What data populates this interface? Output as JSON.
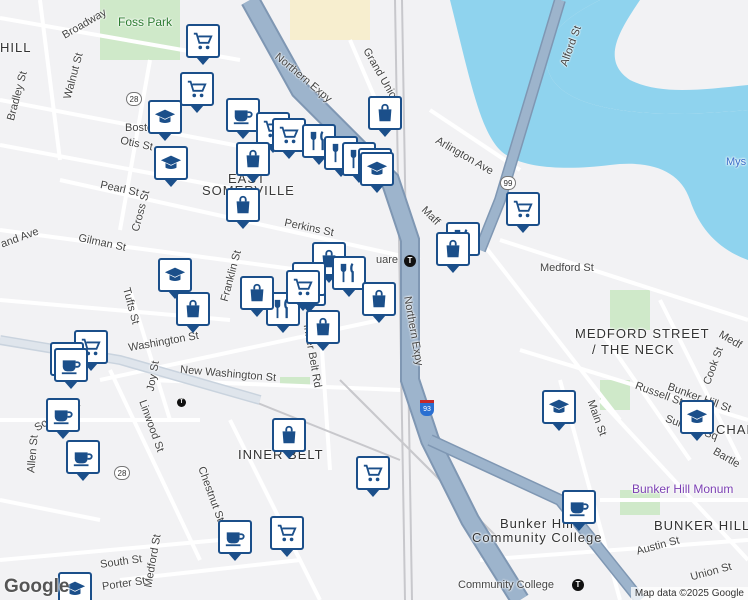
{
  "map": {
    "labels": {
      "foss_park": "Foss Park",
      "broadway": "Broadway",
      "walnut_st": "Walnut St",
      "bradley_st": "Bradley St",
      "boston_ave": "Boston Ave",
      "otis_st": "Otis St",
      "pearl_st": "Pearl St",
      "cross_st": "Cross St",
      "gilman_st": "Gilman St",
      "grand_ave": "and Ave",
      "east_somerville_1": "EAST",
      "east_somerville_2": "SOMERVILLE",
      "perkins_st": "Perkins St",
      "franklin_st": "Franklin St",
      "tufts_st": "Tufts St",
      "washington_st": "Washington St",
      "new_washington_st": "New Washington St",
      "inner_belt_rd": "Inner Belt Rd",
      "joy_st": "Joy St",
      "linwood_st": "Linwood St",
      "allen_st": "Allen St",
      "somerville_ave": "Somerville",
      "chestnut_st": "Chestnut St",
      "inner_belt": "INNER BELT",
      "south_st": "South St",
      "medford_st_w": "Medford St",
      "porter_st": "Porter St",
      "northern_expy_1": "Northern Expy",
      "northern_expy_2": "Northern Expy",
      "grand_union": "Grand Union",
      "arlington_ave": "Arlington Ave",
      "alford_st": "Alford St",
      "medford_st_e": "Medford St",
      "medford_street_neck_1": "MEDFORD STREET",
      "medford_street_neck_2": "/ THE NECK",
      "bunker_hill_st": "Bunker Hill St",
      "russell_st": "Russell St",
      "cook_st": "Cook St",
      "main_st": "Main St",
      "sullivan_sq": "Sullivan Sq",
      "bartlett": "Bartle",
      "bunker_hill_monument": "Bunker Hill Monum",
      "bunker_hill_area": "BUNKER HILL",
      "bunker_hill_cc_1": "Bunker Hill",
      "bunker_hill_cc_2": "Community College",
      "community_college_station": "Community College",
      "austin_st": "Austin St",
      "union_st": "Union St",
      "mys": "Mys",
      "hill": "HILL",
      "char": "CHAR",
      "medf": "Medf",
      "square": "uare",
      "maff": "Maff"
    },
    "route_28_a": "28",
    "route_28_b": "28",
    "route_99": "99",
    "interstate_93": "93",
    "transit_symbol": "T",
    "google_logo": "Google",
    "attribution": "Map data ©2025 Google",
    "colors": {
      "water": "#8fd3ee",
      "highway": "#9db4cc",
      "highway_edge": "#7f97b3",
      "road": "#ffffff",
      "park": "#cfe9c9",
      "pin_border": "#1b4f8a",
      "industrial": "#f7eecf"
    },
    "markers": [
      {
        "icon": "shopping-cart-icon"
      },
      {
        "icon": "shopping-cart-icon"
      },
      {
        "icon": "graduation-cap-icon"
      },
      {
        "icon": "coffee-cup-icon"
      },
      {
        "icon": "shopping-cart-icon"
      },
      {
        "icon": "shopping-cart-icon"
      },
      {
        "icon": "restaurant-icon"
      },
      {
        "icon": "restaurant-icon"
      },
      {
        "icon": "restaurant-icon"
      },
      {
        "icon": "restaurant-icon"
      },
      {
        "icon": "shopping-bag-icon"
      },
      {
        "icon": "graduation-cap-icon"
      },
      {
        "icon": "graduation-cap-icon"
      },
      {
        "icon": "shopping-bag-icon"
      },
      {
        "icon": "shopping-bag-icon"
      },
      {
        "icon": "restaurant-icon"
      },
      {
        "icon": "graduation-cap-icon"
      },
      {
        "icon": "shopping-bag-icon"
      },
      {
        "icon": "shopping-bag-icon"
      },
      {
        "icon": "shopping-cart-icon"
      },
      {
        "icon": "restaurant-icon"
      },
      {
        "icon": "restaurant-icon"
      },
      {
        "icon": "shopping-bag-icon"
      },
      {
        "icon": "restaurant-icon"
      },
      {
        "icon": "shopping-bag-icon"
      },
      {
        "icon": "shopping-bag-icon"
      },
      {
        "icon": "shopping-bag-icon"
      },
      {
        "icon": "shopping-cart-icon"
      },
      {
        "icon": "shopping-cart-icon"
      },
      {
        "icon": "coffee-cup-icon"
      },
      {
        "icon": "coffee-cup-icon"
      },
      {
        "icon": "shopping-cart-icon"
      },
      {
        "icon": "coffee-cup-icon"
      },
      {
        "icon": "coffee-cup-icon"
      },
      {
        "icon": "shopping-bag-icon"
      },
      {
        "icon": "shopping-cart-icon"
      },
      {
        "icon": "coffee-cup-icon"
      },
      {
        "icon": "shopping-cart-icon"
      },
      {
        "icon": "graduation-cap-icon"
      },
      {
        "icon": "graduation-cap-icon"
      },
      {
        "icon": "coffee-cup-icon"
      },
      {
        "icon": "graduation-cap-icon"
      }
    ]
  }
}
